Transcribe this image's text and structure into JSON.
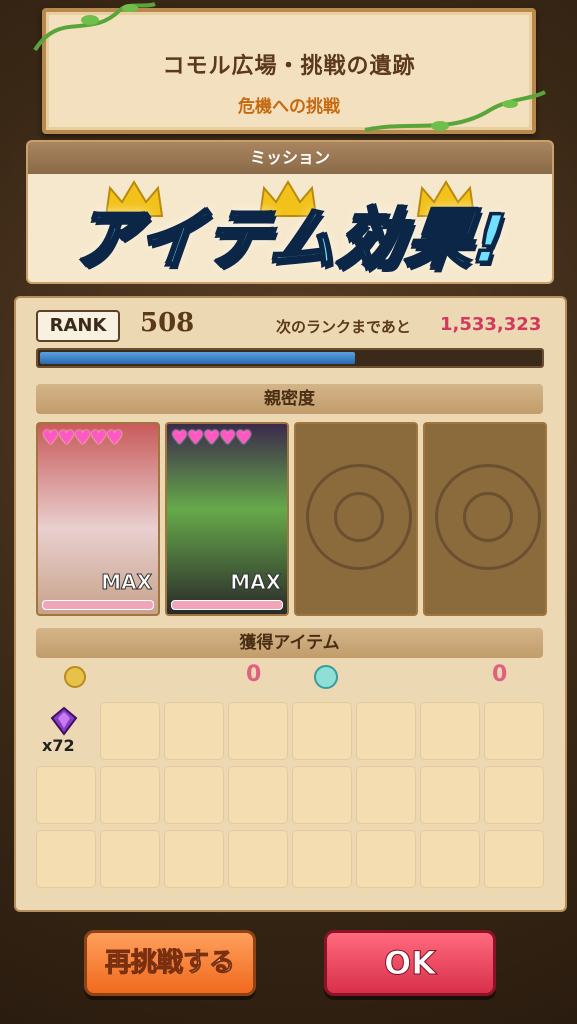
{
  "title": {
    "main": "コモル広場・挑戦の遺跡",
    "sub": "危機への挑戦"
  },
  "mission": {
    "header": "ミッション",
    "crowns": 3
  },
  "banner": "アイテム効果!",
  "rank": {
    "label": "RANK",
    "value": "508",
    "next_label": "次のランクまであと",
    "next_value": "1,533,323",
    "progress": 0.63
  },
  "affinity": {
    "header": "親密度",
    "cards": [
      {
        "filled": true,
        "hearts": "♥♥♥♥♥",
        "max_label": "MAX"
      },
      {
        "filled": true,
        "hearts": "♥♥♥♥♥",
        "max_label": "MAX"
      },
      {
        "filled": false
      },
      {
        "filled": false
      }
    ]
  },
  "items": {
    "header": "獲得アイテム",
    "coin_count": "0",
    "gem_count": "0",
    "grid": [
      {
        "icon": "crystal-icon",
        "qty": "x72"
      }
    ],
    "grid_rows": 3,
    "grid_cols": 8
  },
  "buttons": {
    "retry": "再挑戦する",
    "ok": "OK"
  },
  "colors": {
    "accent_pink": "#d13a5e",
    "retry_orange": "#f06a1e",
    "ok_red": "#d8304a",
    "rank_bar": "#2a6ab0"
  }
}
